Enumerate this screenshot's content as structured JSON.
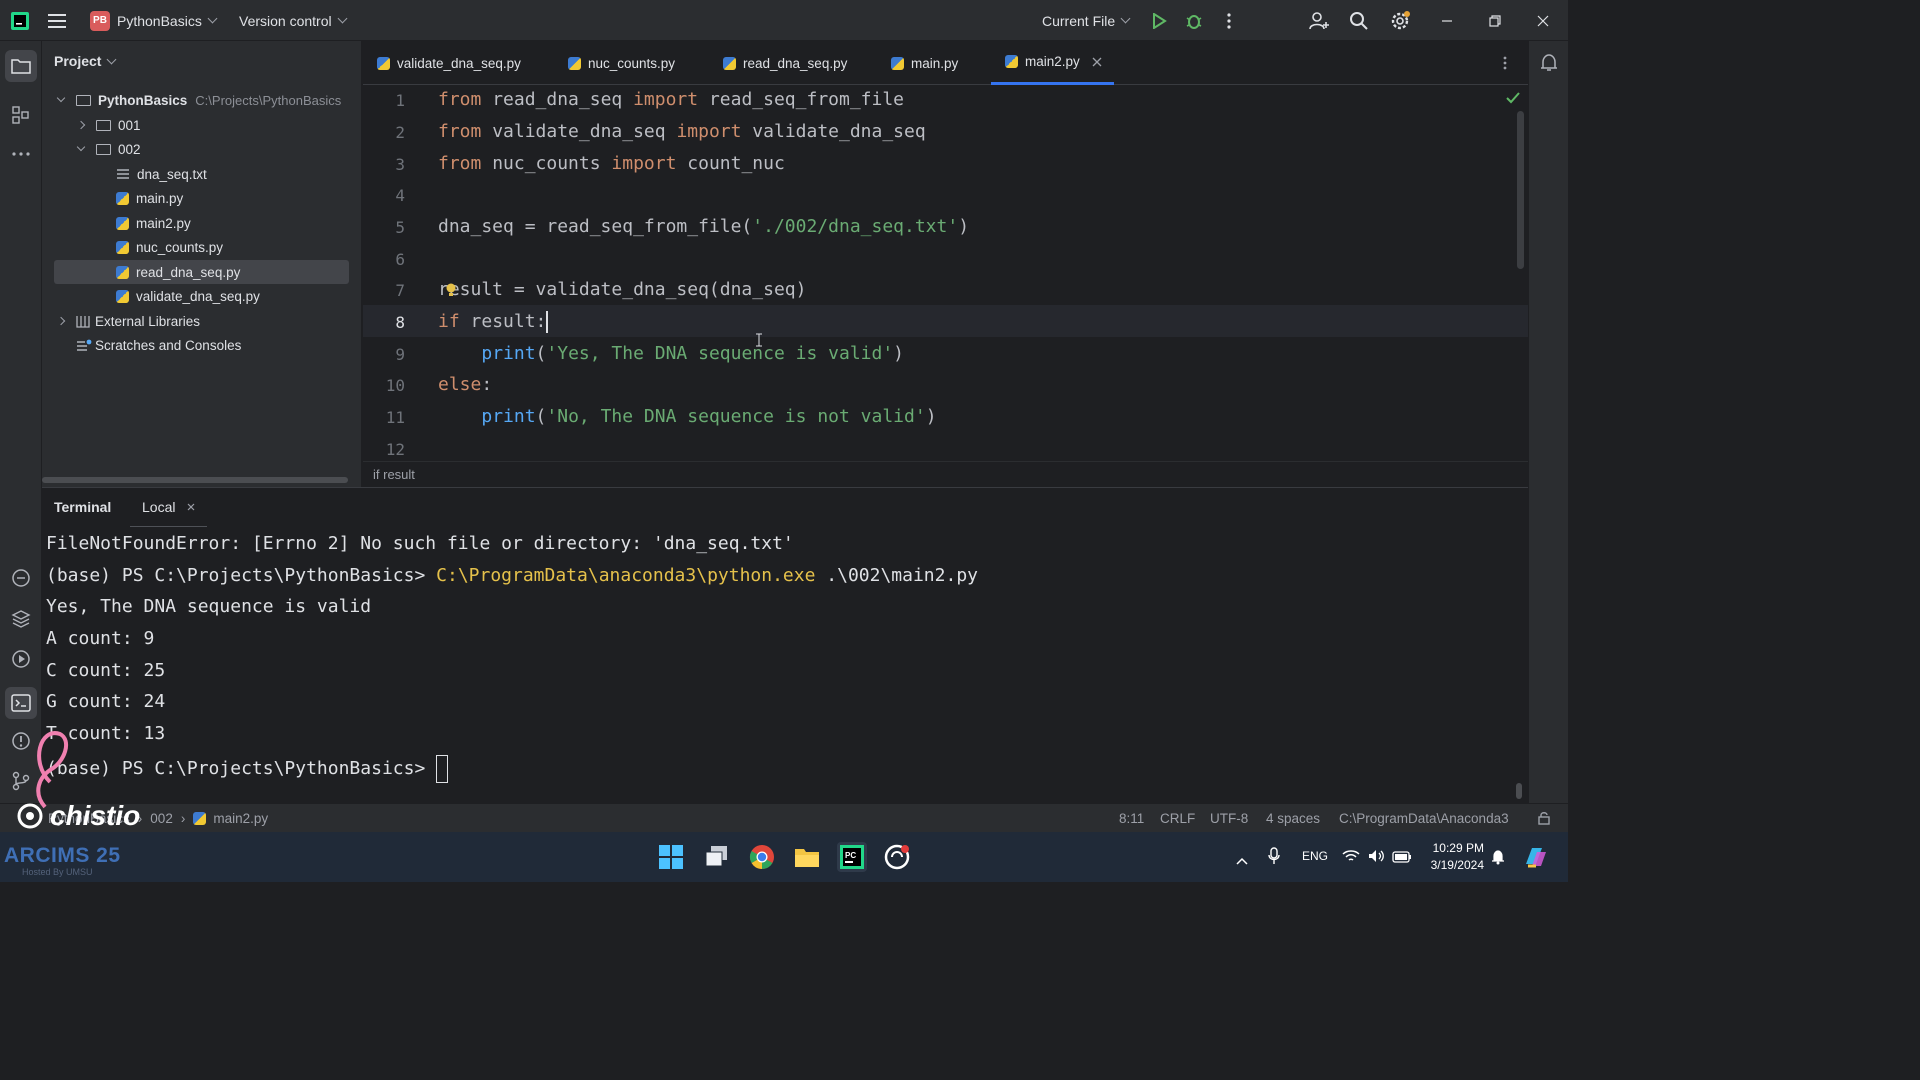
{
  "topbar": {
    "project_badge": "PB",
    "project_name": "PythonBasics",
    "vcs": "Version control",
    "run_config": "Current File"
  },
  "project_panel": {
    "title": "Project",
    "root_name": "PythonBasics",
    "root_path": "C:\\Projects\\PythonBasics",
    "folder_001": "001",
    "folder_002": "002",
    "files": [
      "dna_seq.txt",
      "main.py",
      "main2.py",
      "nuc_counts.py",
      "read_dna_seq.py",
      "validate_dna_seq.py"
    ],
    "external_libraries": "External Libraries",
    "scratches": "Scratches and Consoles"
  },
  "tabs": [
    "validate_dna_seq.py",
    "nuc_counts.py",
    "read_dna_seq.py",
    "main.py",
    "main2.py"
  ],
  "editor": {
    "line_numbers": [
      "1",
      "2",
      "3",
      "4",
      "5",
      "6",
      "7",
      "8",
      "9",
      "10",
      "11",
      "12"
    ],
    "breadcrumb": "if result"
  },
  "terminal": {
    "title": "Terminal",
    "tab": "Local",
    "lines": [
      "FileNotFoundError: [Errno 2] No such file or directory: 'dna_seq.txt'",
      "(base) PS C:\\Projects\\PythonBasics> ",
      "Yes, The DNA sequence is valid",
      "A count: 9",
      "C count: 25",
      "G count: 24",
      "T count: 13",
      "(base) PS C:\\Projects\\PythonBasics> "
    ],
    "command_exe": "C:\\ProgramData\\anaconda3\\python.exe",
    "command_arg": " .\\002\\main2.py"
  },
  "status": {
    "path_root": "PythonBasics",
    "path_folder": "002",
    "path_file": "main2.py",
    "position": "8:11",
    "line_sep": "CRLF",
    "encoding": "UTF-8",
    "indent": "4 spaces",
    "interpreter": "C:\\ProgramData\\Anaconda3"
  },
  "taskbar": {
    "watermark": "ARCIMS 25",
    "watermark_sub": "Hosted By UMSU",
    "lang": "ENG",
    "time": "10:29 PM",
    "date": "3/19/2024"
  },
  "overlay": {
    "logo_text": "chistio"
  },
  "colors": {
    "keyword": "#cf8e6d",
    "string": "#6aab73",
    "function": "#56a8f5",
    "accent": "#3574f0",
    "run_green": "#5fb865"
  }
}
